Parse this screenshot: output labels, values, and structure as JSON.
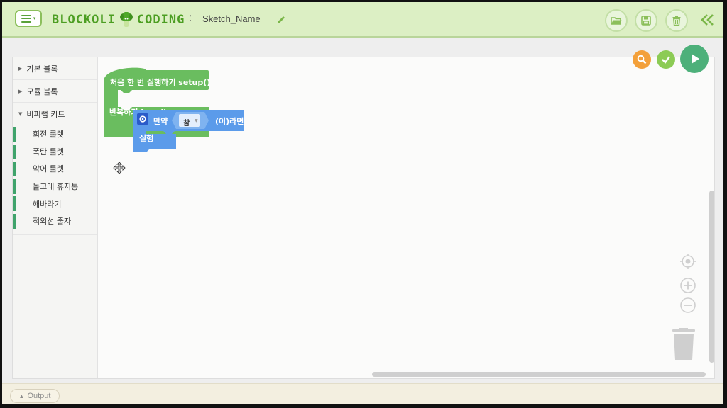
{
  "header": {
    "brand_left": "BLOCKOLI",
    "brand_right": "CODING",
    "separator": ":",
    "sketch_name": "Sketch_Name",
    "icons": [
      "menu-icon",
      "broccoli-logo-icon",
      "pencil-icon",
      "folder-open-icon",
      "save-icon",
      "trash-icon",
      "double-chevron-left-icon"
    ]
  },
  "sidebar": {
    "categories": [
      {
        "label": "기본 블록"
      },
      {
        "label": "모듈 블록"
      },
      {
        "label": "비피랩 키트"
      }
    ],
    "kit_items": [
      "회전 룰렛",
      "폭탄 룰렛",
      "악어 룰렛",
      "돌고래 휴지통",
      "해바라기",
      "적외선 줄자"
    ],
    "item_accent_color": "#3fa36b"
  },
  "blocks": {
    "setup_label": "처음 한 번 실행하기 setup()",
    "loop_label": "반복하기 loop()",
    "if_label": "만약",
    "bool_value": "참",
    "then_label": "(이)라면",
    "do_label": "실행",
    "event_color": "#6abd5f",
    "logic_color": "#5b9bea"
  },
  "workspace_controls": {
    "icons": [
      "search-zoom-icon",
      "check-icon",
      "play-icon",
      "recenter-icon",
      "zoom-in-icon",
      "zoom-out-icon",
      "trash-icon"
    ],
    "colors": {
      "search": "#f3a03a",
      "check": "#8ccb55",
      "play": "#4db07a"
    }
  },
  "footer": {
    "output_label": "Output"
  }
}
